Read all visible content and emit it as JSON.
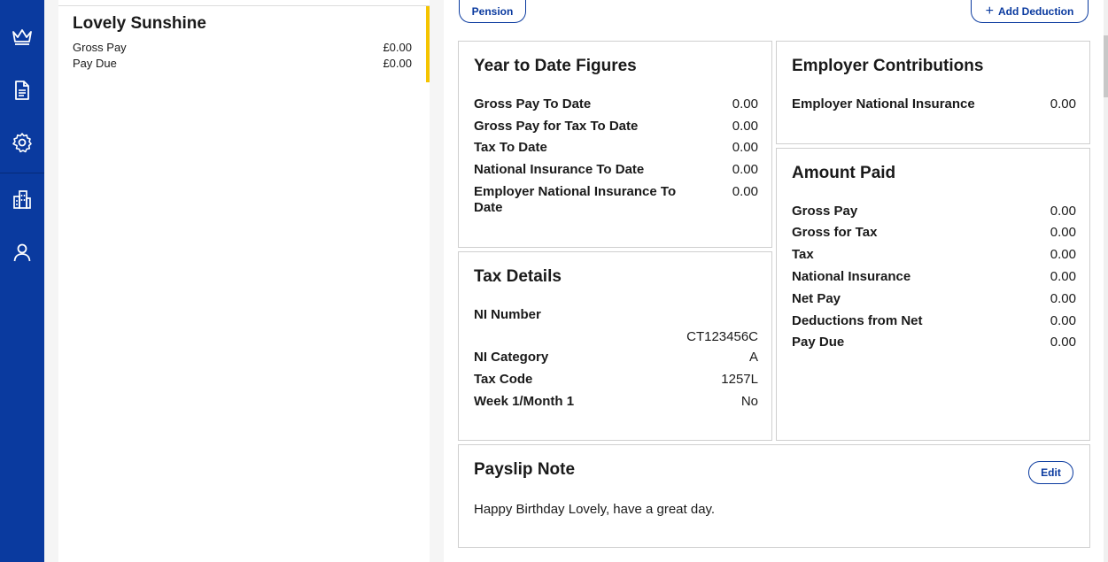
{
  "sidebar": {
    "items": [
      {
        "icon": "crown-icon"
      },
      {
        "icon": "document-icon"
      },
      {
        "icon": "gear-icon"
      },
      {
        "icon": "building-icon"
      },
      {
        "icon": "user-icon"
      }
    ]
  },
  "employee": {
    "name": "Lovely Sunshine",
    "gross_pay_label": "Gross Pay",
    "gross_pay_value": "£0.00",
    "pay_due_label": "Pay Due",
    "pay_due_value": "£0.00",
    "accent_color": "#f5c400"
  },
  "toolbar": {
    "pension_label": "Pension",
    "add_deduction_label": "Add Deduction"
  },
  "ytd": {
    "title": "Year to Date Figures",
    "rows": [
      {
        "label": "Gross Pay To Date",
        "value": "0.00"
      },
      {
        "label": "Gross Pay for Tax To Date",
        "value": "0.00"
      },
      {
        "label": "Tax To Date",
        "value": "0.00"
      },
      {
        "label": "National Insurance To Date",
        "value": "0.00"
      },
      {
        "label": "Employer National Insurance To Date",
        "value": "0.00"
      }
    ]
  },
  "employer": {
    "title": "Employer Contributions",
    "rows": [
      {
        "label": "Employer National Insurance",
        "value": "0.00"
      }
    ]
  },
  "tax": {
    "title": "Tax Details",
    "ni_number_label": "NI Number",
    "ni_number_value": "CT123456C",
    "rows": [
      {
        "label": "NI Category",
        "value": "A"
      },
      {
        "label": "Tax Code",
        "value": "1257L"
      },
      {
        "label": "Week 1/Month 1",
        "value": "No"
      }
    ]
  },
  "paid": {
    "title": "Amount Paid",
    "rows": [
      {
        "label": "Gross Pay",
        "value": "0.00"
      },
      {
        "label": "Gross for Tax",
        "value": "0.00"
      },
      {
        "label": "Tax",
        "value": "0.00"
      },
      {
        "label": "National Insurance",
        "value": "0.00"
      },
      {
        "label": "Net Pay",
        "value": "0.00"
      },
      {
        "label": "Deductions from Net",
        "value": "0.00"
      },
      {
        "label": "Pay Due",
        "value": "0.00"
      }
    ]
  },
  "note": {
    "title": "Payslip Note",
    "edit_label": "Edit",
    "text": "Happy Birthday Lovely, have a great day."
  },
  "colors": {
    "brand": "#0a3a9f",
    "accent": "#f5c400"
  }
}
